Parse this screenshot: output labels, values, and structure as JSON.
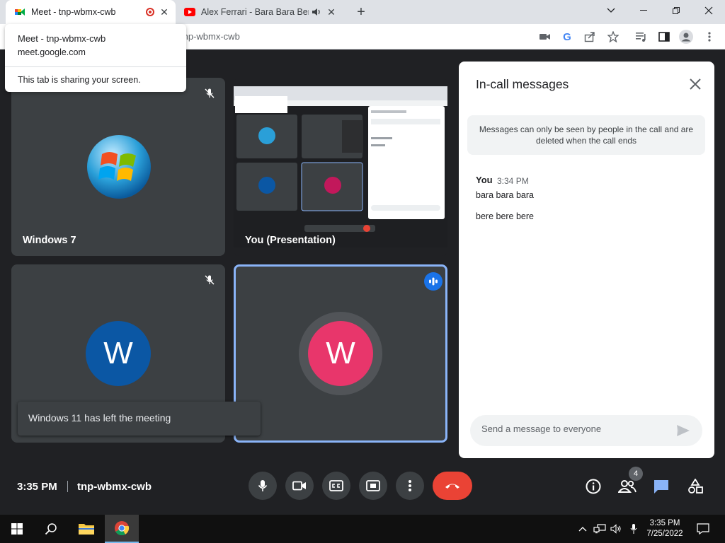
{
  "browser": {
    "tabs": [
      {
        "title": "Meet - tnp-wbmx-cwb"
      },
      {
        "title": "Alex Ferrari - Bara Bara Bere Bere"
      }
    ],
    "url": "tnp-wbmx-cwb",
    "new_tab": "+"
  },
  "tab_tooltip": {
    "title": "Meet - tnp-wbmx-cwb",
    "domain": "meet.google.com",
    "note": "This tab is sharing your screen."
  },
  "tiles": [
    {
      "name": "Windows 7"
    },
    {
      "name": "You (Presentation)"
    },
    {
      "name": "",
      "avatar_letter": "W"
    },
    {
      "name": "",
      "avatar_letter": "W"
    }
  ],
  "toast": {
    "text": "Windows 11 has left the meeting"
  },
  "chat": {
    "title": "In-call messages",
    "notice": "Messages can only be seen by people in the call and are deleted when the call ends",
    "messages": [
      {
        "sender": "You",
        "time": "3:34 PM",
        "lines": [
          "bara bara bara",
          "bere bere bere"
        ]
      }
    ],
    "placeholder": "Send a message to everyone"
  },
  "bottombar": {
    "time": "3:35 PM",
    "meeting_code": "tnp-wbmx-cwb",
    "participants_count": "4"
  },
  "taskbar": {
    "time": "3:35 PM",
    "date": "7/25/2022"
  },
  "colors": {
    "accent": "#1a73e8",
    "hangup": "#ea4335",
    "avatar_blue": "#0b57a4",
    "avatar_pink": "#e8366b"
  }
}
